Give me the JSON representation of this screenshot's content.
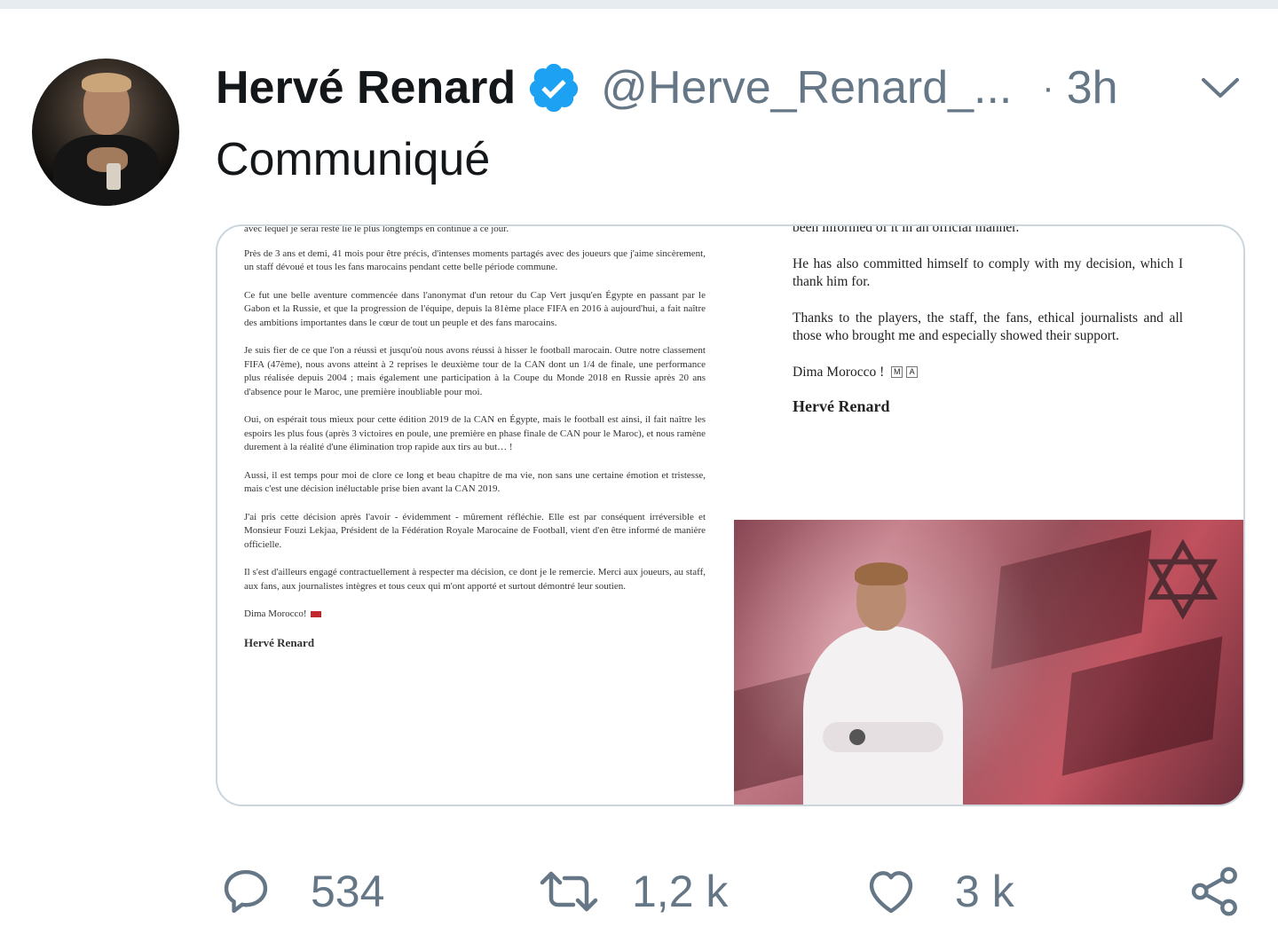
{
  "tweet": {
    "author_name": "Hervé Renard",
    "handle": "@Herve_Renard_...",
    "separator": "·",
    "time": "3h",
    "text": "Communiqué"
  },
  "document_left": {
    "cut_line": "avec lequel je serai resté lié le plus longtemps en continue à ce jour.",
    "paragraphs": [
      "Près de 3 ans et demi, 41 mois pour être précis, d'intenses moments partagés avec des joueurs que j'aime sincèrement, un staff dévoué et tous les fans marocains pendant cette belle période commune.",
      "Ce fut une belle aventure commencée dans l'anonymat d'un retour du Cap Vert jusqu'en Égypte en passant par le Gabon et la Russie, et que la progression de l'équipe, depuis la 81ème place FIFA en 2016 à aujourd'hui, a fait naître des ambitions importantes dans le cœur de tout un peuple et des fans marocains.",
      "Je suis fier de ce que l'on a réussi et jusqu'où nous avons réussi à hisser le football marocain. Outre notre classement FIFA (47ème), nous avons atteint à 2 reprises le deuxième tour de la CAN dont un 1/4 de finale, une performance plus réalisée depuis 2004 ; mais également une participation à la Coupe du Monde 2018 en Russie après 20 ans d'absence pour le Maroc, une première inoubliable pour moi.",
      "Oui, on espérait tous mieux pour cette édition 2019 de la CAN en Égypte, mais le football est ainsi, il fait naître les espoirs les plus fous (après 3 victoires en poule, une première en phase finale de CAN pour le Maroc), et nous ramène durement à la réalité d'une élimination trop rapide aux tirs au but… !",
      "Aussi, il est temps pour moi de clore ce long et beau chapitre de ma vie, non sans une certaine émotion et tristesse, mais c'est une décision inéluctable prise bien avant la CAN 2019.",
      "J'ai pris cette décision après l'avoir - évidemment - mûrement réfléchie. Elle est par conséquent irréversible et Monsieur Fouzi Lekjaa, Président de la Fédération Royale Marocaine de Football, vient d'en être informé de manière officielle.",
      "Il s'est d'ailleurs engagé contractuellement à respecter ma décision, ce dont je le remercie. Merci aux joueurs, au staff, aux fans, aux journalistes intègres et tous ceux qui m'ont apporté et surtout démontré leur soutien."
    ],
    "closing": "Dima Morocco!",
    "signature": "Hervé Renard"
  },
  "document_right": {
    "cut_line": "been informed of it in an official manner.",
    "paragraphs": [
      "He has also committed himself to comply with my decision, which I thank him for.",
      "Thanks to the players, the staff, the fans, ethical journalists and all those who brought me and especially showed their support."
    ],
    "closing": "Dima Morocco !",
    "box_m": "M",
    "box_a": "A",
    "signature": "Hervé Renard"
  },
  "actions": {
    "replies": "534",
    "retweets": "1,2 k",
    "likes": "3 k"
  },
  "colors": {
    "verified_blue": "#1da1f2",
    "secondary_text": "#657786",
    "primary_text": "#14171a",
    "media_border": "#ccd6dd"
  },
  "icons": [
    "verified-badge-icon",
    "chevron-down-icon",
    "reply-icon",
    "retweet-icon",
    "like-icon",
    "share-icon"
  ]
}
